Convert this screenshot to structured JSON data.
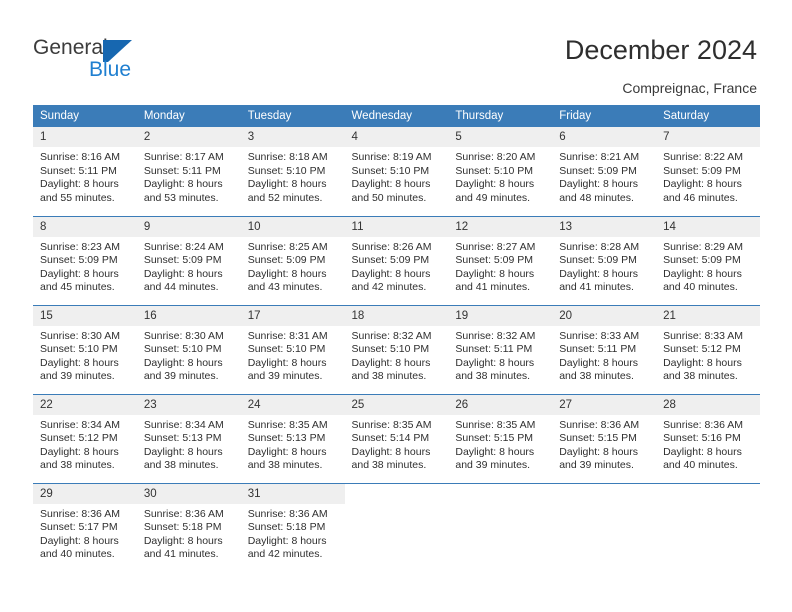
{
  "brand": {
    "name_top": "General",
    "name_bottom": "Blue",
    "logo_icon": "general-blue-flag-icon",
    "accent_color": "#1767b0",
    "blue_text_color": "#1f7fd0"
  },
  "header": {
    "title": "December 2024",
    "subtitle": "Compreignac, France"
  },
  "theme": {
    "header_blue": "#3b7cb8",
    "daynum_background": "#efefef",
    "text_color": "#2f2f2f"
  },
  "calendar": {
    "weekday_headers": [
      "Sunday",
      "Monday",
      "Tuesday",
      "Wednesday",
      "Thursday",
      "Friday",
      "Saturday"
    ],
    "weeks": [
      [
        {
          "day": "1",
          "sunrise": "Sunrise: 8:16 AM",
          "sunset": "Sunset: 5:11 PM",
          "daylight_line1": "Daylight: 8 hours",
          "daylight_line2": "and 55 minutes."
        },
        {
          "day": "2",
          "sunrise": "Sunrise: 8:17 AM",
          "sunset": "Sunset: 5:11 PM",
          "daylight_line1": "Daylight: 8 hours",
          "daylight_line2": "and 53 minutes."
        },
        {
          "day": "3",
          "sunrise": "Sunrise: 8:18 AM",
          "sunset": "Sunset: 5:10 PM",
          "daylight_line1": "Daylight: 8 hours",
          "daylight_line2": "and 52 minutes."
        },
        {
          "day": "4",
          "sunrise": "Sunrise: 8:19 AM",
          "sunset": "Sunset: 5:10 PM",
          "daylight_line1": "Daylight: 8 hours",
          "daylight_line2": "and 50 minutes."
        },
        {
          "day": "5",
          "sunrise": "Sunrise: 8:20 AM",
          "sunset": "Sunset: 5:10 PM",
          "daylight_line1": "Daylight: 8 hours",
          "daylight_line2": "and 49 minutes."
        },
        {
          "day": "6",
          "sunrise": "Sunrise: 8:21 AM",
          "sunset": "Sunset: 5:09 PM",
          "daylight_line1": "Daylight: 8 hours",
          "daylight_line2": "and 48 minutes."
        },
        {
          "day": "7",
          "sunrise": "Sunrise: 8:22 AM",
          "sunset": "Sunset: 5:09 PM",
          "daylight_line1": "Daylight: 8 hours",
          "daylight_line2": "and 46 minutes."
        }
      ],
      [
        {
          "day": "8",
          "sunrise": "Sunrise: 8:23 AM",
          "sunset": "Sunset: 5:09 PM",
          "daylight_line1": "Daylight: 8 hours",
          "daylight_line2": "and 45 minutes."
        },
        {
          "day": "9",
          "sunrise": "Sunrise: 8:24 AM",
          "sunset": "Sunset: 5:09 PM",
          "daylight_line1": "Daylight: 8 hours",
          "daylight_line2": "and 44 minutes."
        },
        {
          "day": "10",
          "sunrise": "Sunrise: 8:25 AM",
          "sunset": "Sunset: 5:09 PM",
          "daylight_line1": "Daylight: 8 hours",
          "daylight_line2": "and 43 minutes."
        },
        {
          "day": "11",
          "sunrise": "Sunrise: 8:26 AM",
          "sunset": "Sunset: 5:09 PM",
          "daylight_line1": "Daylight: 8 hours",
          "daylight_line2": "and 42 minutes."
        },
        {
          "day": "12",
          "sunrise": "Sunrise: 8:27 AM",
          "sunset": "Sunset: 5:09 PM",
          "daylight_line1": "Daylight: 8 hours",
          "daylight_line2": "and 41 minutes."
        },
        {
          "day": "13",
          "sunrise": "Sunrise: 8:28 AM",
          "sunset": "Sunset: 5:09 PM",
          "daylight_line1": "Daylight: 8 hours",
          "daylight_line2": "and 41 minutes."
        },
        {
          "day": "14",
          "sunrise": "Sunrise: 8:29 AM",
          "sunset": "Sunset: 5:09 PM",
          "daylight_line1": "Daylight: 8 hours",
          "daylight_line2": "and 40 minutes."
        }
      ],
      [
        {
          "day": "15",
          "sunrise": "Sunrise: 8:30 AM",
          "sunset": "Sunset: 5:10 PM",
          "daylight_line1": "Daylight: 8 hours",
          "daylight_line2": "and 39 minutes."
        },
        {
          "day": "16",
          "sunrise": "Sunrise: 8:30 AM",
          "sunset": "Sunset: 5:10 PM",
          "daylight_line1": "Daylight: 8 hours",
          "daylight_line2": "and 39 minutes."
        },
        {
          "day": "17",
          "sunrise": "Sunrise: 8:31 AM",
          "sunset": "Sunset: 5:10 PM",
          "daylight_line1": "Daylight: 8 hours",
          "daylight_line2": "and 39 minutes."
        },
        {
          "day": "18",
          "sunrise": "Sunrise: 8:32 AM",
          "sunset": "Sunset: 5:10 PM",
          "daylight_line1": "Daylight: 8 hours",
          "daylight_line2": "and 38 minutes."
        },
        {
          "day": "19",
          "sunrise": "Sunrise: 8:32 AM",
          "sunset": "Sunset: 5:11 PM",
          "daylight_line1": "Daylight: 8 hours",
          "daylight_line2": "and 38 minutes."
        },
        {
          "day": "20",
          "sunrise": "Sunrise: 8:33 AM",
          "sunset": "Sunset: 5:11 PM",
          "daylight_line1": "Daylight: 8 hours",
          "daylight_line2": "and 38 minutes."
        },
        {
          "day": "21",
          "sunrise": "Sunrise: 8:33 AM",
          "sunset": "Sunset: 5:12 PM",
          "daylight_line1": "Daylight: 8 hours",
          "daylight_line2": "and 38 minutes."
        }
      ],
      [
        {
          "day": "22",
          "sunrise": "Sunrise: 8:34 AM",
          "sunset": "Sunset: 5:12 PM",
          "daylight_line1": "Daylight: 8 hours",
          "daylight_line2": "and 38 minutes."
        },
        {
          "day": "23",
          "sunrise": "Sunrise: 8:34 AM",
          "sunset": "Sunset: 5:13 PM",
          "daylight_line1": "Daylight: 8 hours",
          "daylight_line2": "and 38 minutes."
        },
        {
          "day": "24",
          "sunrise": "Sunrise: 8:35 AM",
          "sunset": "Sunset: 5:13 PM",
          "daylight_line1": "Daylight: 8 hours",
          "daylight_line2": "and 38 minutes."
        },
        {
          "day": "25",
          "sunrise": "Sunrise: 8:35 AM",
          "sunset": "Sunset: 5:14 PM",
          "daylight_line1": "Daylight: 8 hours",
          "daylight_line2": "and 38 minutes."
        },
        {
          "day": "26",
          "sunrise": "Sunrise: 8:35 AM",
          "sunset": "Sunset: 5:15 PM",
          "daylight_line1": "Daylight: 8 hours",
          "daylight_line2": "and 39 minutes."
        },
        {
          "day": "27",
          "sunrise": "Sunrise: 8:36 AM",
          "sunset": "Sunset: 5:15 PM",
          "daylight_line1": "Daylight: 8 hours",
          "daylight_line2": "and 39 minutes."
        },
        {
          "day": "28",
          "sunrise": "Sunrise: 8:36 AM",
          "sunset": "Sunset: 5:16 PM",
          "daylight_line1": "Daylight: 8 hours",
          "daylight_line2": "and 40 minutes."
        }
      ],
      [
        {
          "day": "29",
          "sunrise": "Sunrise: 8:36 AM",
          "sunset": "Sunset: 5:17 PM",
          "daylight_line1": "Daylight: 8 hours",
          "daylight_line2": "and 40 minutes."
        },
        {
          "day": "30",
          "sunrise": "Sunrise: 8:36 AM",
          "sunset": "Sunset: 5:18 PM",
          "daylight_line1": "Daylight: 8 hours",
          "daylight_line2": "and 41 minutes."
        },
        {
          "day": "31",
          "sunrise": "Sunrise: 8:36 AM",
          "sunset": "Sunset: 5:18 PM",
          "daylight_line1": "Daylight: 8 hours",
          "daylight_line2": "and 42 minutes."
        },
        {
          "day": "",
          "sunrise": "",
          "sunset": "",
          "daylight_line1": "",
          "daylight_line2": ""
        },
        {
          "day": "",
          "sunrise": "",
          "sunset": "",
          "daylight_line1": "",
          "daylight_line2": ""
        },
        {
          "day": "",
          "sunrise": "",
          "sunset": "",
          "daylight_line1": "",
          "daylight_line2": ""
        },
        {
          "day": "",
          "sunrise": "",
          "sunset": "",
          "daylight_line1": "",
          "daylight_line2": ""
        }
      ]
    ]
  }
}
